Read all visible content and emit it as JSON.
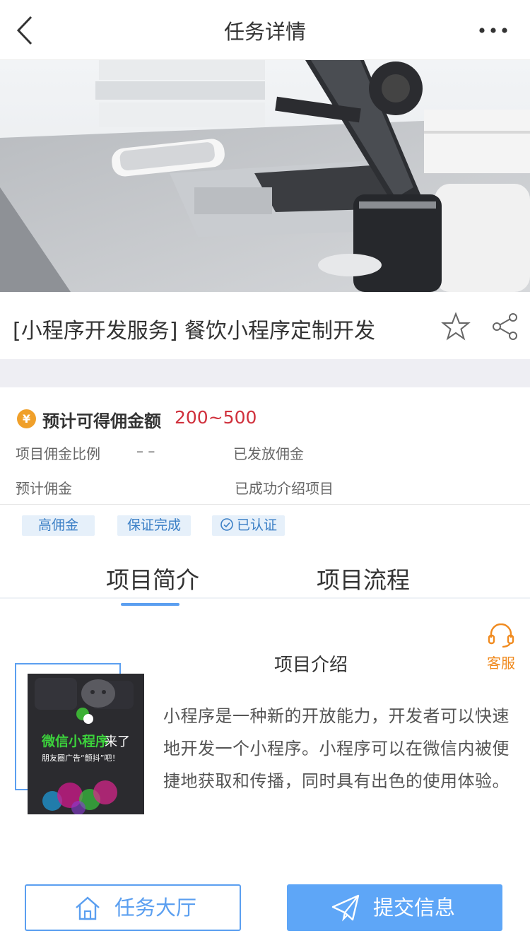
{
  "header": {
    "title": "任务详情",
    "back_icon": "chevron-left-icon",
    "more_icon": "more-dots-icon"
  },
  "task": {
    "title": "[小程序开发服务] 餐饮小程序定制开发"
  },
  "commission": {
    "coin_symbol": "¥",
    "label": "预计可得佣金额",
    "value": "200~500",
    "ratio_label": "项目佣金比例",
    "ratio_value": "– –",
    "issued_label": "已发放佣金",
    "estimate_label": "预计佣金",
    "success_label": "已成功介绍项目"
  },
  "tags": [
    "高佣金",
    "保证完成",
    "已认证"
  ],
  "tabs": [
    "项目简介",
    "项目流程"
  ],
  "intro": {
    "title": "项目介绍",
    "text": "小程序是一种新的开放能力，开发者可以快速地开发一个小程序。小程序可以在微信内被便捷地获取和传播，同时具有出色的使用体验。",
    "image_line1_highlight": "微信小程序",
    "image_line1_rest": "来了",
    "image_line2": "朋友圈广告“颤抖”吧！"
  },
  "customer_service": {
    "label": "客服"
  },
  "buttons": {
    "hall": "任务大厅",
    "submit": "提交信息"
  },
  "colors": {
    "accent": "#5ea6f7",
    "price": "#d0303c",
    "service": "#f08a1e",
    "tag_bg": "#e6f0fa",
    "tag_text": "#3b7fc6"
  }
}
